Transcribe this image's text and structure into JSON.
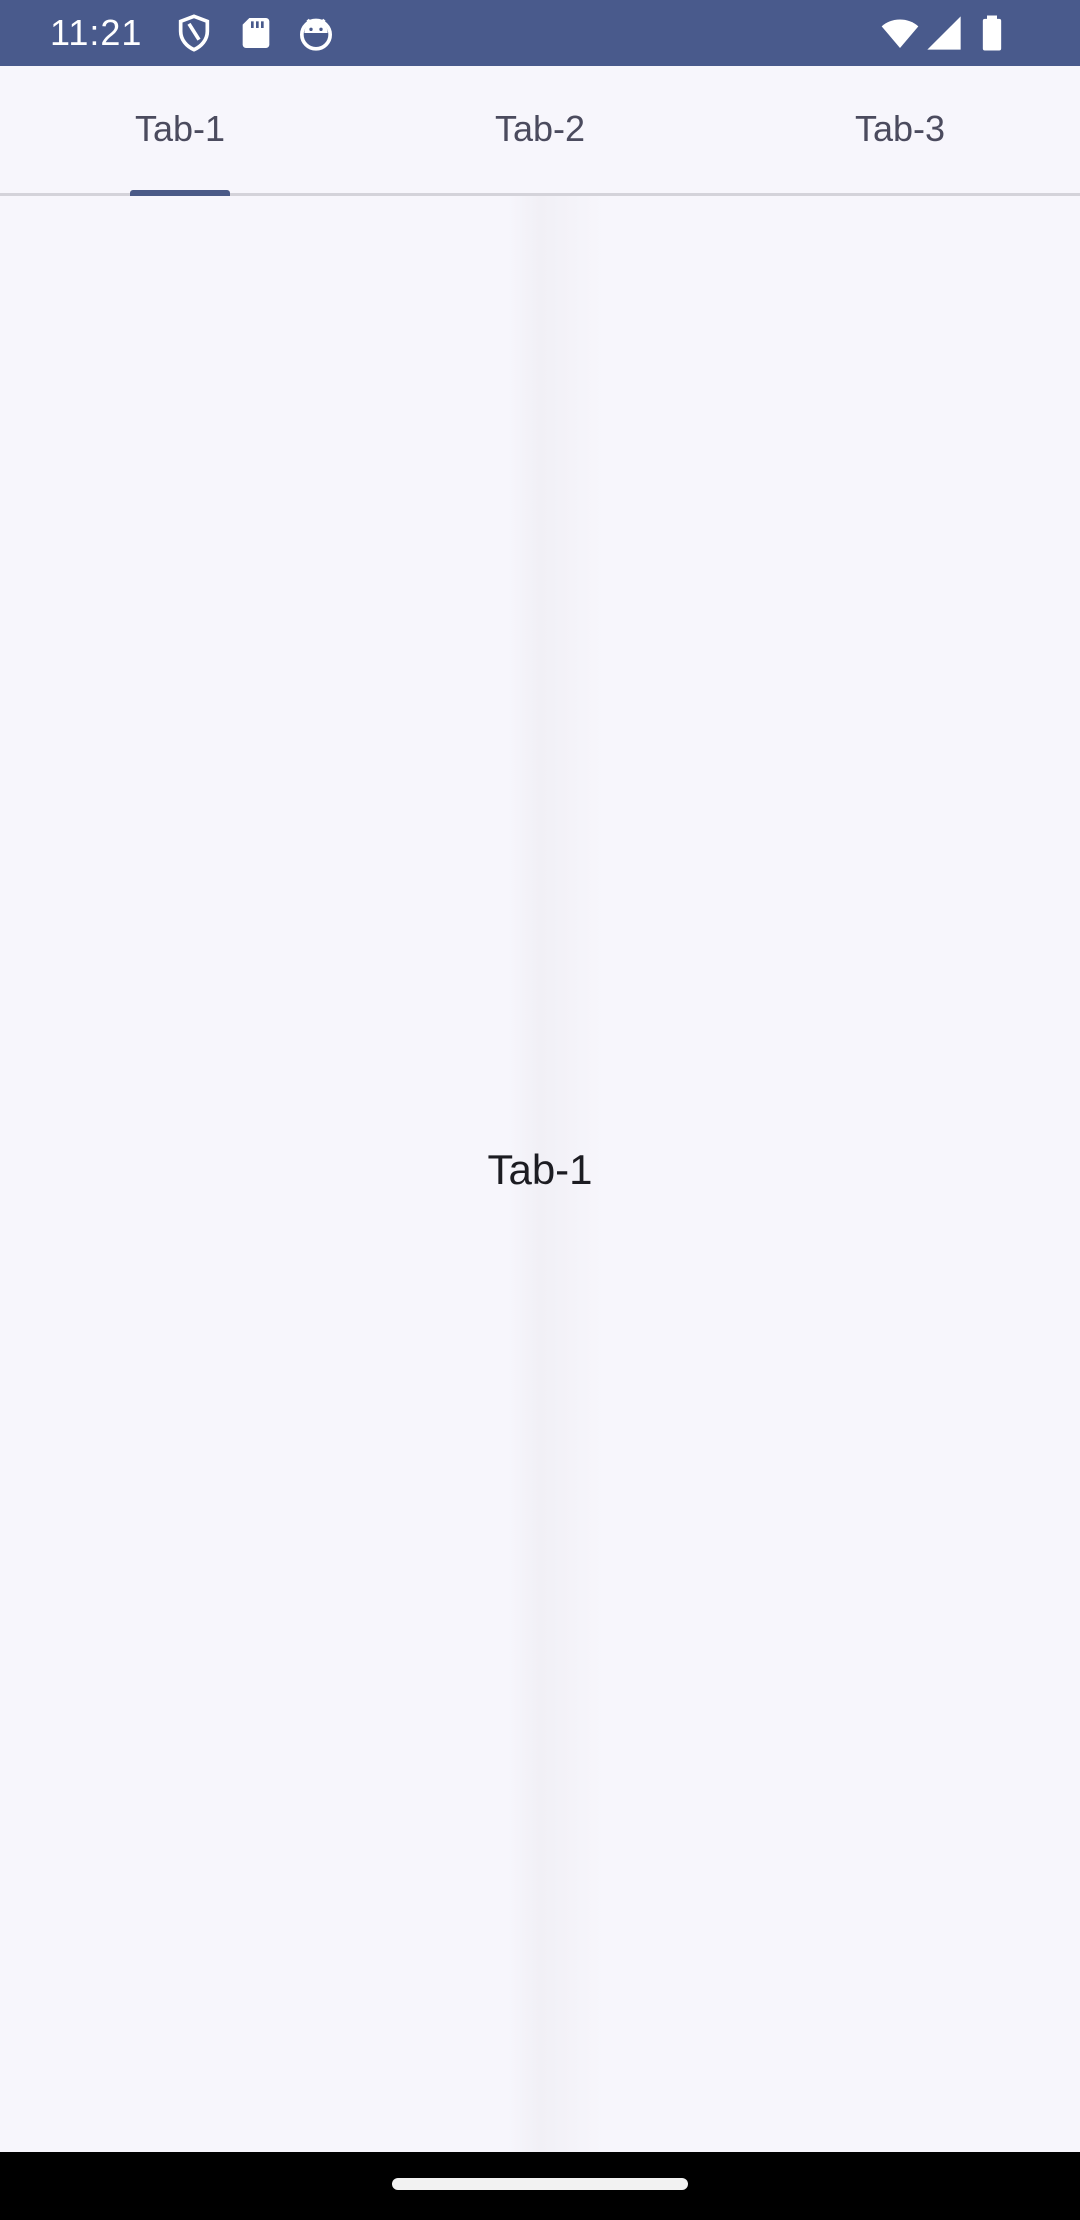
{
  "status_bar": {
    "time": "11:21",
    "icons_left": [
      "shield-icon",
      "sd-card-icon",
      "android-head-icon"
    ],
    "icons_right": [
      "wifi-icon",
      "cellular-signal-icon",
      "battery-icon"
    ],
    "background_color": "#495a8c"
  },
  "tabs": [
    {
      "label": "Tab-1",
      "selected": true
    },
    {
      "label": "Tab-2",
      "selected": false
    },
    {
      "label": "Tab-3",
      "selected": false
    }
  ],
  "content": {
    "text": "Tab-1"
  },
  "colors": {
    "accent": "#4b5a87",
    "background": "#f7f6fc",
    "tab_text": "#4b4b5e"
  }
}
